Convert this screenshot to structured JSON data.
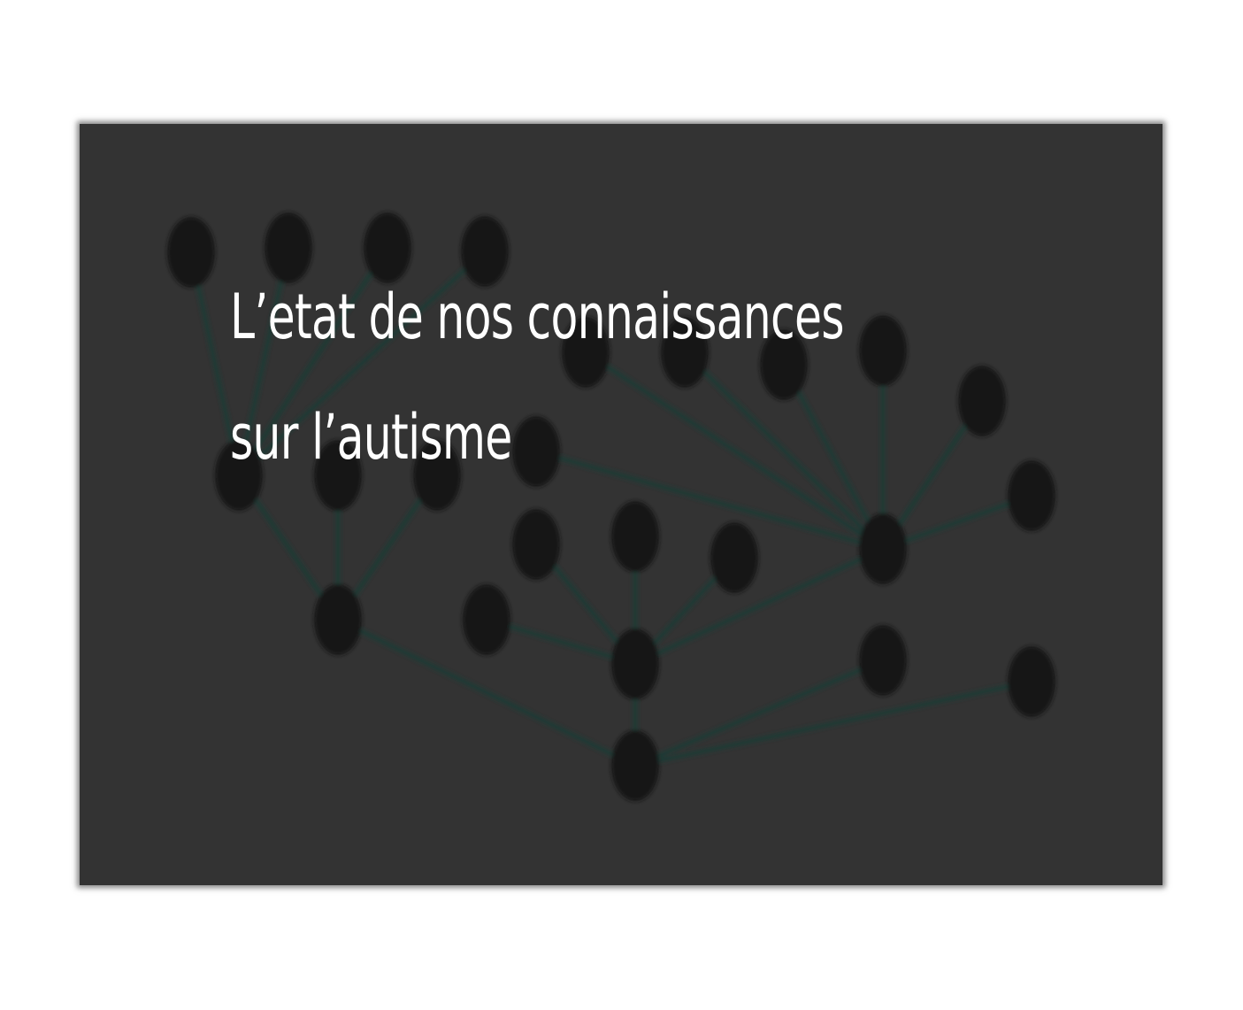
{
  "title": {
    "line1": "L’etat de nos connaissances",
    "line2": "sur l’autisme"
  },
  "colors": {
    "page_background": "#ffffff",
    "card_background": "#333333",
    "node_fill": "#151515",
    "edge_stroke": "#1f3a36",
    "title_text": "#ffffff"
  },
  "graphic": {
    "type": "network-graph-background",
    "node_count": 27
  }
}
